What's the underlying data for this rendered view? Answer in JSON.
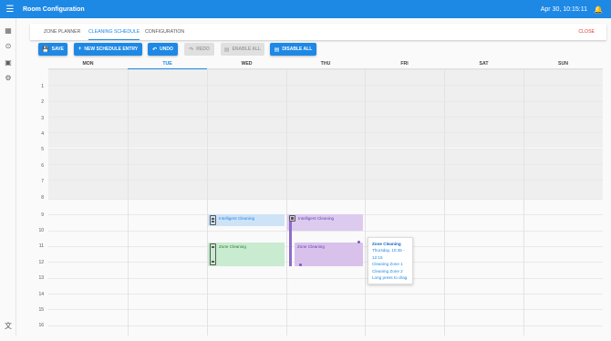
{
  "appbar": {
    "menu_icon": "menu-icon",
    "title": "Room Configuration",
    "clock": "Apr 30, 10:15:11",
    "bell_icon": "bell-icon"
  },
  "rail": [
    {
      "icon": "dashboard-icon",
      "glyph": "▦"
    },
    {
      "icon": "play-circle-icon",
      "glyph": "⊙"
    },
    {
      "icon": "picture-in-picture-icon",
      "glyph": "▣"
    },
    {
      "icon": "settings-icon",
      "glyph": "⚙"
    }
  ],
  "lang_icon": "translate-icon",
  "tabs": [
    "Zone Planner",
    "Cleaning Schedule",
    "Configuration"
  ],
  "active_tab": "Cleaning Schedule",
  "close_label": "Close",
  "toolbar": {
    "save": "Save",
    "new_entry": "New Schedule Entry",
    "undo": "Undo",
    "redo": "Redo",
    "enable_all": "Enable All",
    "disable_all": "Disable All"
  },
  "days": [
    "MON",
    "TUE",
    "WED",
    "THU",
    "FRI",
    "SAT",
    "SUN"
  ],
  "today": "TUE",
  "hours": [
    "1",
    "2",
    "3",
    "4",
    "5",
    "6",
    "7",
    "8",
    "9",
    "10",
    "11",
    "12",
    "13",
    "14",
    "15",
    "16"
  ],
  "events": {
    "wed_intel": "Intelligent Cleaning",
    "wed_zone": "Zone Cleaning",
    "thu_intel": "Intelligent Cleaning",
    "thu_zone": "Zone Cleaning"
  },
  "tooltip": {
    "title": "Zone Cleaning",
    "time": "Thursday, 10:45 - 12:15",
    "zone1": "Cleaning Zone 1",
    "zone2": "Cleaning Zone 2",
    "hint": "Long press to drag"
  },
  "colors": {
    "primary": "#1e88e5",
    "close": "#e53935",
    "blue_event": "#cfe3f7",
    "green_event": "#c9ebd0",
    "purple_event": "#dccbee"
  }
}
